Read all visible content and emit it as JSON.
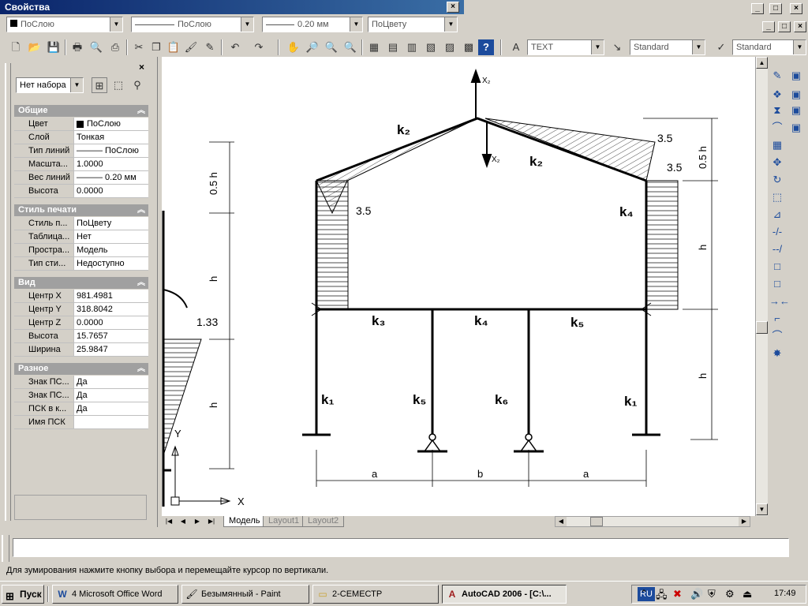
{
  "window": {
    "props_title": "Свойства",
    "min": "_",
    "max": "□",
    "close": "×"
  },
  "toolbar1": {
    "layer_combo": "ПоСлою",
    "linetype_combo": "ПоСлою",
    "lineweight_combo": "0.20 мм",
    "plotstyle_combo": "ПоЦвету"
  },
  "toolbar2": {
    "text_style": "TEXT",
    "dim_style": "Standard",
    "table_style": "Standard"
  },
  "props_panel": {
    "selection": "Нет набора",
    "sections": [
      {
        "title": "Общие",
        "rows": [
          {
            "k": "Цвет",
            "v": "ПоСлою"
          },
          {
            "k": "Слой",
            "v": "Тонкая"
          },
          {
            "k": "Тип линий",
            "v": "——— ПоСлою"
          },
          {
            "k": "Масшта...",
            "v": "1.0000"
          },
          {
            "k": "Вес линий",
            "v": "——— 0.20 мм"
          },
          {
            "k": "Высота",
            "v": "0.0000"
          }
        ]
      },
      {
        "title": "Стиль печати",
        "rows": [
          {
            "k": "Стиль п...",
            "v": "ПоЦвету"
          },
          {
            "k": "Таблица...",
            "v": "Нет"
          },
          {
            "k": "Простра...",
            "v": "Модель"
          },
          {
            "k": "Тип сти...",
            "v": "Недоступно"
          }
        ]
      },
      {
        "title": "Вид",
        "rows": [
          {
            "k": "Центр X",
            "v": "981.4981"
          },
          {
            "k": "Центр Y",
            "v": "318.8042"
          },
          {
            "k": "Центр Z",
            "v": "0.0000"
          },
          {
            "k": "Высота",
            "v": "15.7657"
          },
          {
            "k": "Ширина",
            "v": "25.9847"
          }
        ]
      },
      {
        "title": "Разное",
        "rows": [
          {
            "k": "Знак ПС...",
            "v": "Да"
          },
          {
            "k": "Знак ПС...",
            "v": "Да"
          },
          {
            "k": "ПСК в к...",
            "v": "Да"
          },
          {
            "k": "Имя ПСК",
            "v": ""
          }
        ]
      }
    ]
  },
  "drawing": {
    "labels": {
      "k2_left": "k₂",
      "k2_right": "k₂",
      "k4_top": "k₄",
      "k3": "k₃",
      "k4_mid": "k₄",
      "k5_beam": "k₅",
      "k1_left": "k₁",
      "k5_col": "k₅",
      "k6_col": "k₆",
      "k1_right": "k₁",
      "x2_up": "X₂",
      "x2_down": "X₂",
      "v35_a": "3.5",
      "v35_b": "3.5",
      "v35_c": "3.5",
      "v133": "1.33",
      "dim_05h_left": "0.5 h",
      "dim_h_left1": "h",
      "dim_h_left2": "h",
      "dim_05h_right": "0.5 h",
      "dim_h_right1": "h",
      "dim_h_right2": "h",
      "dim_a1": "a",
      "dim_b": "b",
      "dim_a2": "a",
      "ucs_y": "Y",
      "ucs_x": "X"
    }
  },
  "tabs": [
    "Модель",
    "Layout1",
    "Layout2"
  ],
  "status": "Для зумирования нажмите кнопку выбора и перемещайте курсор по вертикали.",
  "taskbar": {
    "start": "Пуск",
    "tasks": [
      "4 Microsoft Office Word",
      "Безымянный - Paint",
      "2-СЕМЕСТР",
      "AutoCAD 2006 - [C:\\..."
    ],
    "lang": "RU",
    "clock": "17:49"
  }
}
